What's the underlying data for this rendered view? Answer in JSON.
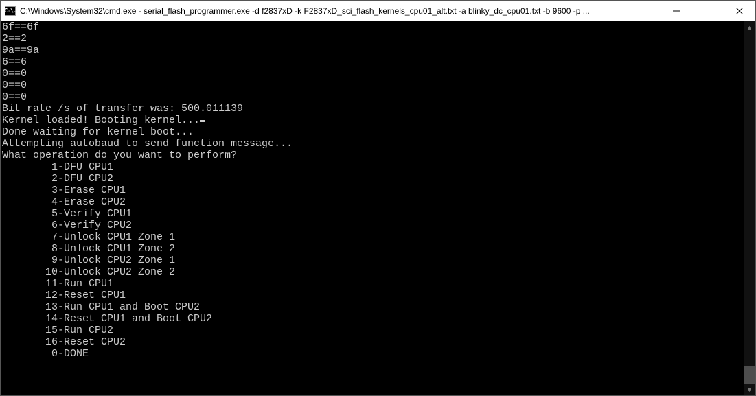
{
  "window": {
    "title": "C:\\Windows\\System32\\cmd.exe - serial_flash_programmer.exe  -d f2837xD -k F2837xD_sci_flash_kernels_cpu01_alt.txt -a blinky_dc_cpu01.txt -b 9600 -p ...",
    "icon_text": "C:\\."
  },
  "terminal": {
    "lines": [
      "6f==6f",
      "2==2",
      "9a==9a",
      "6==6",
      "0==0",
      "0==0",
      "0==0",
      "Bit rate /s of transfer was: 500.011139",
      "Kernel loaded! Booting kernel...",
      "Done waiting for kernel boot...",
      "Attempting autobaud to send function message...",
      "What operation do you want to perform?",
      "        1-DFU CPU1",
      "        2-DFU CPU2",
      "        3-Erase CPU1",
      "        4-Erase CPU2",
      "        5-Verify CPU1",
      "        6-Verify CPU2",
      "        7-Unlock CPU1 Zone 1",
      "        8-Unlock CPU1 Zone 2",
      "        9-Unlock CPU2 Zone 1",
      "       10-Unlock CPU2 Zone 2",
      "       11-Run CPU1",
      "       12-Reset CPU1",
      "       13-Run CPU1 and Boot CPU2",
      "       14-Reset CPU1 and Boot CPU2",
      "       15-Run CPU2",
      "       16-Reset CPU2",
      "        0-DONE"
    ],
    "cursor_line_index": 8
  }
}
